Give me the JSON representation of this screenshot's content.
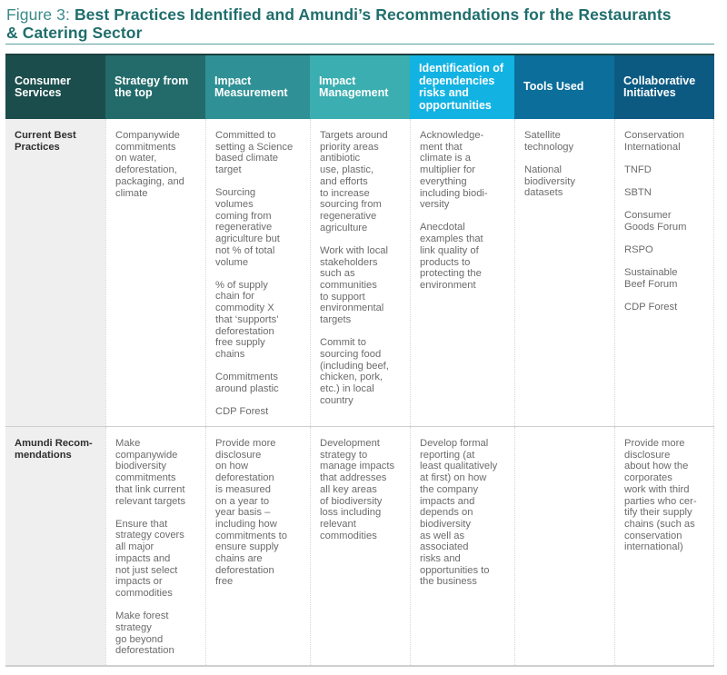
{
  "figure": {
    "prefix": "Figure 3: ",
    "title_line1": "Best Practices Identified and Amundi’s Recommendations for the Restaurants",
    "title_line2": "& Catering Sector"
  },
  "colors": {
    "header_col0": "#1b4d4c",
    "header_col1": "#236b6b",
    "header_col2": "#2f9196",
    "header_col3": "#3aaeb0",
    "header_col4": "#12b3e3",
    "header_col5": "#0b6e9b",
    "header_col6": "#0c5a82",
    "row_header_bg": "#efefef",
    "title_text": "#1f6e6c"
  },
  "table": {
    "columns": [
      "Consumer\nServices",
      "Strategy from\nthe top",
      "Impact\nMeasurement",
      "Impact\nManagement",
      "Identification of\ndependencies\nrisks and\nopportunities",
      "Tools Used",
      "Collaborative\nInitiatives"
    ],
    "rows": [
      {
        "label": "Current Best\nPractices",
        "cells": [
          [
            "Companywide\ncommitments\non water,\ndeforestation,\npackaging, and\nclimate"
          ],
          [
            "Committed to\nsetting a Science\nbased climate\ntarget",
            "Sourcing\nvolumes\ncoming from\nregenerative\nagriculture but\nnot % of total\nvolume",
            "% of supply\nchain for\ncommodity X\nthat ‘supports’\ndeforestation\nfree supply\nchains",
            "Commitments\naround plastic",
            "CDP Forest"
          ],
          [
            "Targets around\npriority areas\nantibiotic\nuse, plastic,\nand efforts\nto increase\nsourcing from\nregenerative\nagriculture",
            "Work with local\nstakeholders\nsuch as\ncommunities\nto support\nenvironmental\ntargets",
            "Commit to\nsourcing food\n(including beef,\nchicken, pork,\netc.) in local\ncountry"
          ],
          [
            "Acknowledge-\nment that\nclimate is a\nmultiplier for\neverything\nincluding biodi-\nversity",
            "Anecdotal\nexamples that\nlink quality of\nproducts to\nprotecting the\nenvironment"
          ],
          [
            "Satellite\ntechnology",
            "National\nbiodiversity\ndatasets"
          ],
          [
            "Conservation\nInternational",
            "TNFD",
            "SBTN",
            "Consumer\nGoods Forum",
            "RSPO",
            "Sustainable\nBeef Forum",
            "CDP Forest"
          ]
        ]
      },
      {
        "label": "Amundi Recom-\nmendations",
        "cells": [
          [
            "Make\ncompanywide\nbiodiversity\ncommitments\nthat link current\nrelevant targets",
            "Ensure that\nstrategy covers\nall major\nimpacts and\nnot just select\nimpacts or\ncommodities",
            "Make forest\nstrategy\ngo beyond\ndeforestation"
          ],
          [
            "Provide more\ndisclosure\non how\ndeforestation\nis measured\non a year to\nyear basis –\nincluding how\ncommitments to\nensure supply\nchains are\ndeforestation\nfree"
          ],
          [
            "Development\nstrategy to\nmanage impacts\nthat addresses\nall key areas\nof biodiversity\nloss including\nrelevant\ncommodities"
          ],
          [
            "Develop formal\nreporting (at\nleast qualitatively\nat first) on how\nthe company\nimpacts and\ndepends on\nbiodiversity\nas well as\nassociated\nrisks and\nopportunities to\nthe business"
          ],
          [],
          [
            "Provide more\ndisclosure\nabout how the\ncorporates\nwork with third\nparties who cer-\ntify their supply\nchains (such as\nconservation\ninternational)"
          ]
        ]
      }
    ]
  }
}
